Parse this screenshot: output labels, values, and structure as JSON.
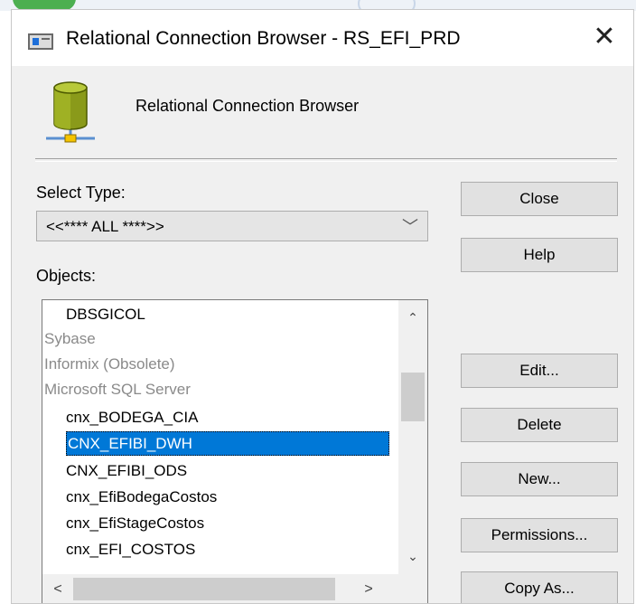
{
  "window": {
    "title": "Relational Connection Browser - RS_EFI_PRD",
    "close_glyph": "✕"
  },
  "header": {
    "text": "Relational Connection Browser",
    "icon": "database-icon"
  },
  "select_type": {
    "label": "Select Type:",
    "value": "<<**** ALL ****>>",
    "arrow": "﹀"
  },
  "objects": {
    "label": "Objects:",
    "items": [
      {
        "text": "DBSGICOL",
        "kind": "connection"
      },
      {
        "text": "Sybase",
        "kind": "group"
      },
      {
        "text": "Informix (Obsolete)",
        "kind": "group"
      },
      {
        "text": "Microsoft SQL Server",
        "kind": "group"
      },
      {
        "text": "cnx_BODEGA_CIA",
        "kind": "connection"
      },
      {
        "text": "CNX_EFIBI_DWH",
        "kind": "connection",
        "selected": true
      },
      {
        "text": "CNX_EFIBI_ODS",
        "kind": "connection"
      },
      {
        "text": "cnx_EfiBodegaCostos",
        "kind": "connection"
      },
      {
        "text": "cnx_EfiStageCostos",
        "kind": "connection"
      },
      {
        "text": "cnx_EFI_COSTOS",
        "kind": "connection"
      }
    ],
    "scroll_up": "⌃",
    "scroll_down": "⌄",
    "scroll_left": "<",
    "scroll_right": ">"
  },
  "buttons": {
    "close": "Close",
    "help": "Help",
    "edit": "Edit...",
    "delete": "Delete",
    "new": "New...",
    "permissions": "Permissions...",
    "copy_as": "Copy As..."
  },
  "colors": {
    "selection": "#0078d7",
    "group_text": "#8a8a8a",
    "dialog_bg": "#f0f0f0"
  }
}
